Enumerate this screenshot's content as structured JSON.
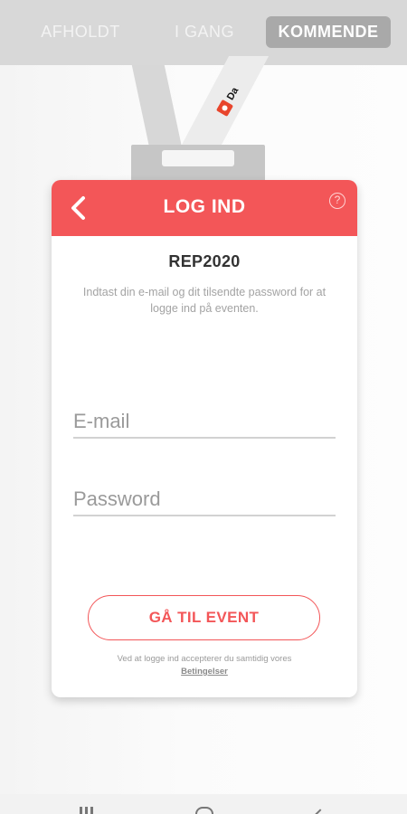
{
  "tabs": [
    {
      "label": "AFHOLDT",
      "active": false
    },
    {
      "label": "I GANG",
      "active": false
    },
    {
      "label": "KOMMENDE",
      "active": true
    }
  ],
  "lanyard": {
    "logo_text": "Da"
  },
  "card": {
    "title": "LOG IND",
    "help_symbol": "?",
    "event_name": "REP2020",
    "instructions": "Indtast din e-mail og dit tilsendte password for at logge ind på eventen.",
    "email": {
      "value": "",
      "placeholder": "E-mail"
    },
    "password": {
      "value": "",
      "placeholder": "Password"
    },
    "submit_label": "GÅ TIL EVENT",
    "terms_text": "Ved at logge ind accepterer du samtidig vores",
    "terms_link": "Betingelser"
  },
  "colors": {
    "accent": "#f35658",
    "tab_active_bg": "#a9a9a9",
    "topbar_bg": "#d8d8d8"
  },
  "icons": {
    "back": "chevron-left-icon",
    "help": "question-circle-icon",
    "nav": [
      "menu-icon",
      "home-icon",
      "back-icon"
    ]
  }
}
